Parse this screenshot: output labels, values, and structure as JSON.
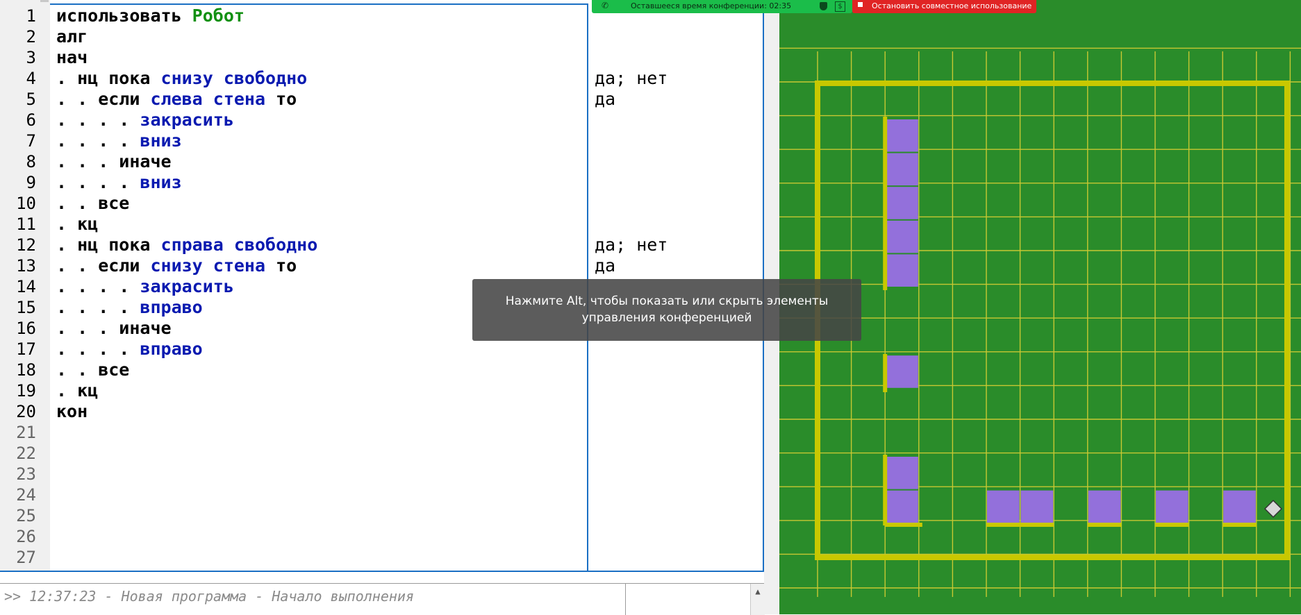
{
  "editor": {
    "lines": [
      {
        "n": "1",
        "tokens": [
          {
            "t": "использовать ",
            "c": "kw"
          },
          {
            "t": "Робот",
            "c": "ispol"
          }
        ],
        "margin": ""
      },
      {
        "n": "2",
        "tokens": [
          {
            "t": "алг",
            "c": "kw"
          }
        ],
        "margin": ""
      },
      {
        "n": "3",
        "tokens": [
          {
            "t": "нач",
            "c": "kw"
          }
        ],
        "margin": ""
      },
      {
        "n": "4",
        "tokens": [
          {
            "t": ". нц пока ",
            "c": "kw"
          },
          {
            "t": "снизу свободно",
            "c": "act"
          }
        ],
        "margin": "да; нет"
      },
      {
        "n": "5",
        "tokens": [
          {
            "t": ". . если ",
            "c": "kw"
          },
          {
            "t": "слева стена",
            "c": "act"
          },
          {
            "t": " то",
            "c": "kw"
          }
        ],
        "margin": "да"
      },
      {
        "n": "6",
        "tokens": [
          {
            "t": ". . . . ",
            "c": "kw"
          },
          {
            "t": "закрасить",
            "c": "act"
          }
        ],
        "margin": ""
      },
      {
        "n": "7",
        "tokens": [
          {
            "t": ". . . . ",
            "c": "kw"
          },
          {
            "t": "вниз",
            "c": "act"
          }
        ],
        "margin": ""
      },
      {
        "n": "8",
        "tokens": [
          {
            "t": ". . . иначе",
            "c": "kw"
          }
        ],
        "margin": ""
      },
      {
        "n": "9",
        "tokens": [
          {
            "t": ". . . . ",
            "c": "kw"
          },
          {
            "t": "вниз",
            "c": "act"
          }
        ],
        "margin": ""
      },
      {
        "n": "10",
        "tokens": [
          {
            "t": ". . все",
            "c": "kw"
          }
        ],
        "margin": ""
      },
      {
        "n": "11",
        "tokens": [
          {
            "t": ". кц",
            "c": "kw"
          }
        ],
        "margin": ""
      },
      {
        "n": "12",
        "tokens": [
          {
            "t": ". нц пока ",
            "c": "kw"
          },
          {
            "t": "справа свободно",
            "c": "act"
          }
        ],
        "margin": "да; нет"
      },
      {
        "n": "13",
        "tokens": [
          {
            "t": ". . если ",
            "c": "kw"
          },
          {
            "t": "снизу стена",
            "c": "act"
          },
          {
            "t": " то",
            "c": "kw"
          }
        ],
        "margin": "да"
      },
      {
        "n": "14",
        "tokens": [
          {
            "t": ". . . . ",
            "c": "kw"
          },
          {
            "t": "закрасить",
            "c": "act"
          }
        ],
        "margin": ""
      },
      {
        "n": "15",
        "tokens": [
          {
            "t": ". . . . ",
            "c": "kw"
          },
          {
            "t": "вправо",
            "c": "act"
          }
        ],
        "margin": ""
      },
      {
        "n": "16",
        "tokens": [
          {
            "t": ". . . иначе",
            "c": "kw"
          }
        ],
        "margin": ""
      },
      {
        "n": "17",
        "tokens": [
          {
            "t": ". . . . ",
            "c": "kw"
          },
          {
            "t": "вправо",
            "c": "act"
          }
        ],
        "margin": ""
      },
      {
        "n": "18",
        "tokens": [
          {
            "t": ". . все",
            "c": "kw"
          }
        ],
        "margin": ""
      },
      {
        "n": "19",
        "tokens": [
          {
            "t": ". кц",
            "c": "kw"
          }
        ],
        "margin": ""
      },
      {
        "n": "20",
        "tokens": [
          {
            "t": "кон",
            "c": "kw"
          }
        ],
        "margin": ""
      },
      {
        "n": "21",
        "tokens": [],
        "margin": ""
      },
      {
        "n": "22",
        "tokens": [],
        "margin": ""
      },
      {
        "n": "23",
        "tokens": [],
        "margin": ""
      },
      {
        "n": "24",
        "tokens": [],
        "margin": ""
      },
      {
        "n": "25",
        "tokens": [],
        "margin": ""
      },
      {
        "n": "26",
        "tokens": [],
        "margin": ""
      },
      {
        "n": "27",
        "tokens": [],
        "margin": ""
      }
    ]
  },
  "console": {
    "text": ">> 12:37:23 - Новая программа - Начало выполнения",
    "scroll_up_icon": "chevron-up-icon"
  },
  "conference": {
    "phone_icon": "phone-icon",
    "remaining_time": "Оставшееся время конференции: 02:35",
    "shield_icon": "shield-icon",
    "dollar_icon": "dollar-icon",
    "stop_sharing": "Остановить совместное использование"
  },
  "tooltip": {
    "text_line1": "Нажмите Alt, чтобы показать или скрыть элементы",
    "text_line2": "управления конференцией"
  },
  "robot_field": {
    "colors": {
      "background": "#2a8c2a",
      "grid": "#c8c832",
      "wall": "#c8c800",
      "painted": "#9370db",
      "robot": "#d8d8d8"
    },
    "grid_rows": 16,
    "grid_cols": 15,
    "painted_cells": [
      [
        3,
        2
      ],
      [
        4,
        2
      ],
      [
        5,
        2
      ],
      [
        6,
        2
      ],
      [
        7,
        2
      ],
      [
        10,
        2
      ],
      [
        13,
        2
      ],
      [
        14,
        2
      ],
      [
        14,
        5
      ],
      [
        14,
        6
      ],
      [
        14,
        8
      ],
      [
        14,
        10
      ],
      [
        14,
        12
      ]
    ],
    "robot_cell": [
      14,
      14
    ],
    "robot_icon": "robot-diamond-icon"
  }
}
